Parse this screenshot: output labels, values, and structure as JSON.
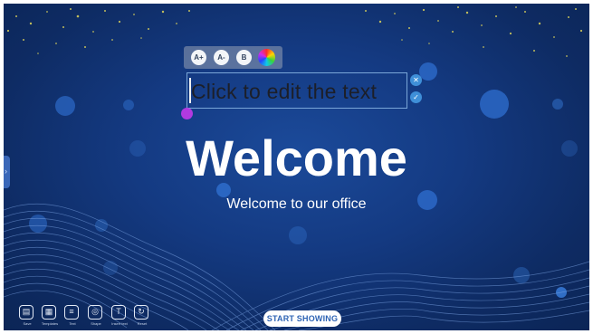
{
  "toolbar": {
    "increase_font": "A+",
    "decrease_font": "A-",
    "bold": "B",
    "color_icon": "color-wheel-icon"
  },
  "textbox": {
    "placeholder": "Click to edit the text",
    "action_top_icon": "delete-icon",
    "action_bottom_icon": "check-icon"
  },
  "slide": {
    "title": "Welcome",
    "subtitle": "Welcome to our office"
  },
  "bottom_toolbar": {
    "items": [
      {
        "label": "Save",
        "icon": "save-icon",
        "glyph": "▤"
      },
      {
        "label": "Templates",
        "icon": "templates-icon",
        "glyph": "▦"
      },
      {
        "label": "Text",
        "icon": "text-box-icon",
        "glyph": "≡"
      },
      {
        "label": "Shape",
        "icon": "shape-icon",
        "glyph": "◎"
      },
      {
        "label": "Insert text",
        "icon": "insert-text-icon",
        "glyph": "T"
      },
      {
        "label": "Reset",
        "icon": "reset-icon",
        "glyph": "↻"
      }
    ]
  },
  "start_button": "START SHOWING",
  "colors": {
    "background": "#143a82",
    "accent": "#2f64b4",
    "handle": "#b23ae0"
  }
}
